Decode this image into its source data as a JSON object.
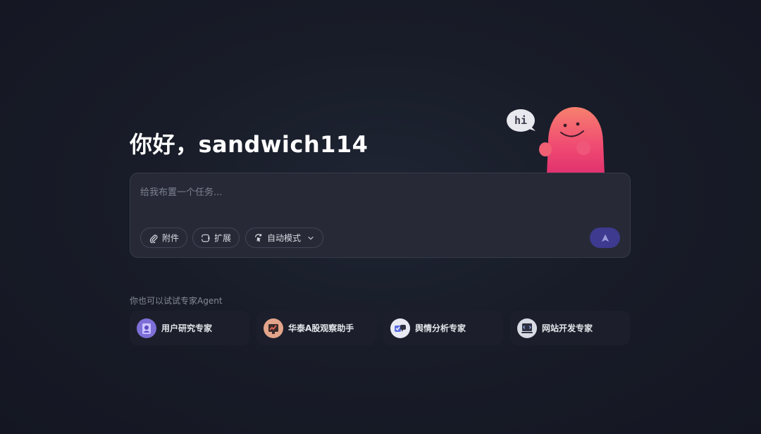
{
  "greeting": "你好，sandwich114",
  "mascot": {
    "bubble_text": "hi"
  },
  "composer": {
    "placeholder": "给我布置一个任务...",
    "attach_label": "附件",
    "extend_label": "扩展",
    "mode_label": "自动模式"
  },
  "experts": {
    "section_label": "你也可以试试专家Agent",
    "items": [
      {
        "label": "用户研究专家",
        "icon": "user-research-icon"
      },
      {
        "label": "华泰A股观察助手",
        "icon": "stock-watch-icon"
      },
      {
        "label": "舆情分析专家",
        "icon": "sentiment-analysis-icon"
      },
      {
        "label": "网站开发专家",
        "icon": "web-dev-icon"
      }
    ]
  },
  "colors": {
    "background": "#181c28",
    "composer": "#272a36",
    "send_button": "#3d3a8f",
    "mascot": "#f0506e"
  }
}
